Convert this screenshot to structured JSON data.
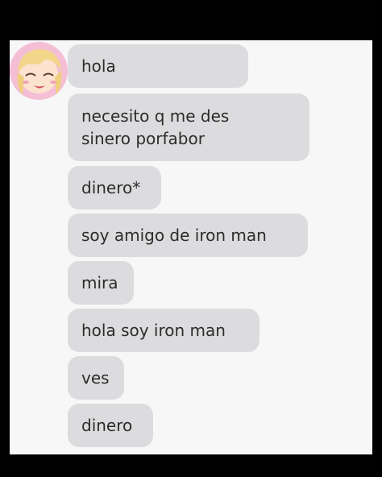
{
  "avatar": {
    "icon": "anime-girl-avatar-icon"
  },
  "messages": [
    {
      "text": "hola"
    },
    {
      "text": "necesito q me des\nsinero porfabor"
    },
    {
      "text": "dinero*"
    },
    {
      "text": "soy amigo de iron man"
    },
    {
      "text": "mira"
    },
    {
      "text": "hola soy iron man"
    },
    {
      "text": "ves"
    },
    {
      "text": "dinero"
    }
  ],
  "colors": {
    "frame": "#000000",
    "screen": "#f7f7f8",
    "bubble": "#dcdcde",
    "text": "#2c2c2c"
  }
}
